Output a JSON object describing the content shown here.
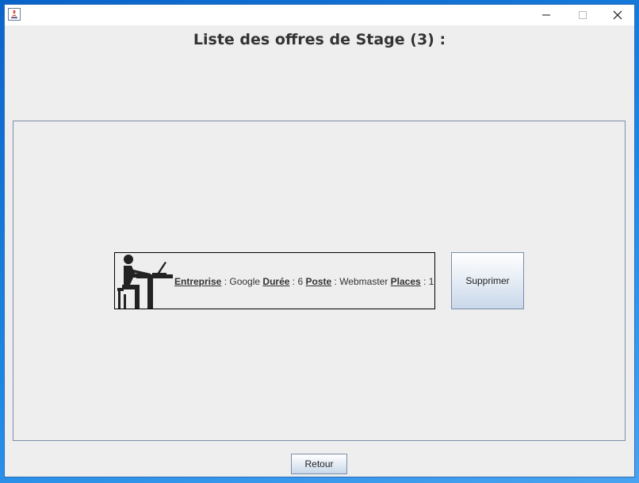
{
  "window": {
    "minimize_glyph": "—",
    "maximize_glyph": "□",
    "close_glyph": "✕"
  },
  "page_title": "Liste des offres de Stage (3) :",
  "offers": [
    {
      "labels": {
        "company": "Entreprise",
        "duration": "Durée",
        "position": "Poste",
        "places": "Places"
      },
      "separator": " : ",
      "company": "Google",
      "duration": "6",
      "position": "Webmaster",
      "places": "1",
      "icon": "person-at-desk-icon"
    }
  ],
  "buttons": {
    "delete_label": "Supprimer",
    "back_label": "Retour"
  },
  "colors": {
    "window_bg": "#eeeeee",
    "panel_border": "#7a8ea8",
    "title_text": "#333333"
  }
}
